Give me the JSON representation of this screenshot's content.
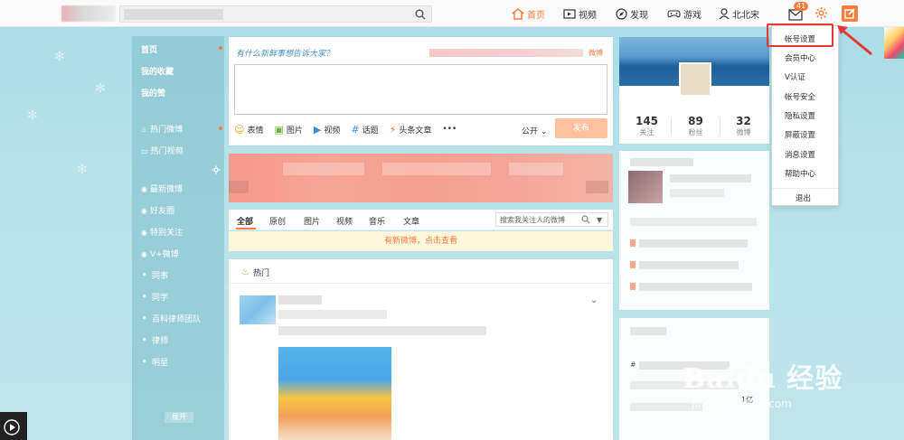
{
  "colors": {
    "accent": "#fa7d3c",
    "highlight_box": "#e53935",
    "background": "#b7e2ea"
  },
  "topbar": {
    "nav": [
      {
        "label": "首页",
        "icon": "home-icon"
      },
      {
        "label": "视频",
        "icon": "video-icon"
      },
      {
        "label": "发现",
        "icon": "compass-icon"
      },
      {
        "label": "游戏",
        "icon": "gamepad-icon"
      },
      {
        "label": "北北宋",
        "icon": "user-icon"
      }
    ],
    "mail_badge": "41",
    "icons": [
      "search-icon",
      "mail-icon",
      "gear-icon",
      "compose-icon"
    ]
  },
  "leftnav": {
    "top_items": [
      "首页",
      "我的收藏",
      "我的赞"
    ],
    "hot_items": [
      "热门微博",
      "热门视频"
    ],
    "group_items": [
      "最新微博",
      "好友圈",
      "特别关注",
      "V+微博"
    ],
    "bullet_items": [
      "同事",
      "同学",
      "百科律师团队",
      "律师",
      "明星"
    ],
    "expand_label": "展开"
  },
  "composer": {
    "prompt": "有什么新鲜事想告诉大家？",
    "weibo_link": "微博",
    "tools": [
      {
        "label": "表情",
        "icon": "smile-icon"
      },
      {
        "label": "图片",
        "icon": "image-icon"
      },
      {
        "label": "视频",
        "icon": "video-icon"
      },
      {
        "label": "话题",
        "icon": "hashtag-icon"
      },
      {
        "label": "头条文章",
        "icon": "lightning-icon"
      },
      {
        "label": "•••",
        "icon": "more-icon"
      }
    ],
    "visibility": "公开",
    "publish": "发布"
  },
  "feed": {
    "tabs": [
      "全部",
      "原创",
      "图片",
      "视频",
      "音乐",
      "文章"
    ],
    "search_placeholder": "搜索我关注人的微博",
    "new_weibo_notice": "有新微博，点击查看",
    "hot_section": "热门"
  },
  "profile": {
    "stats": [
      {
        "num": "145",
        "label": "关注"
      },
      {
        "num": "89",
        "label": "粉丝"
      },
      {
        "num": "32",
        "label": "微博"
      }
    ]
  },
  "right_misc": {
    "hash": "#",
    "count": "1亿"
  },
  "dropdown": {
    "items": [
      "帐号设置",
      "会员中心",
      "V认证",
      "帐号安全",
      "隐私设置",
      "屏蔽设置",
      "消息设置",
      "帮助中心"
    ],
    "logout": "退出"
  },
  "watermark": {
    "big": "Baidu 经验",
    "small": "jingyan.baidu.com"
  }
}
